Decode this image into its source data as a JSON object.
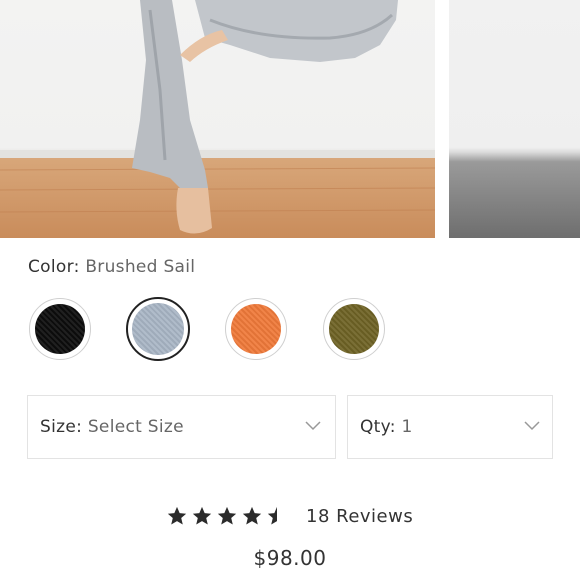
{
  "gallery": {
    "images": [
      {
        "alt": "Model wearing heather grey flared pants"
      },
      {
        "alt": "Product photo thumbnail"
      }
    ]
  },
  "color": {
    "label": "Color:",
    "selected": "Brushed Sail",
    "swatches": [
      {
        "name": "Black",
        "color": "#0d0d0d"
      },
      {
        "name": "Brushed Sail",
        "color": "#a9b6c6",
        "selected": true
      },
      {
        "name": "Orange",
        "color": "#f07a3a"
      },
      {
        "name": "Olive",
        "color": "#6f6325"
      }
    ]
  },
  "size": {
    "label": "Size:",
    "value": "Select Size"
  },
  "qty": {
    "label": "Qty:",
    "value": "1"
  },
  "rating": {
    "stars": 4.5,
    "reviews_text": "18 Reviews"
  },
  "price": "$98.00",
  "colors": {
    "text": "#333333",
    "muted": "#666666",
    "border": "#e3e3e3"
  }
}
